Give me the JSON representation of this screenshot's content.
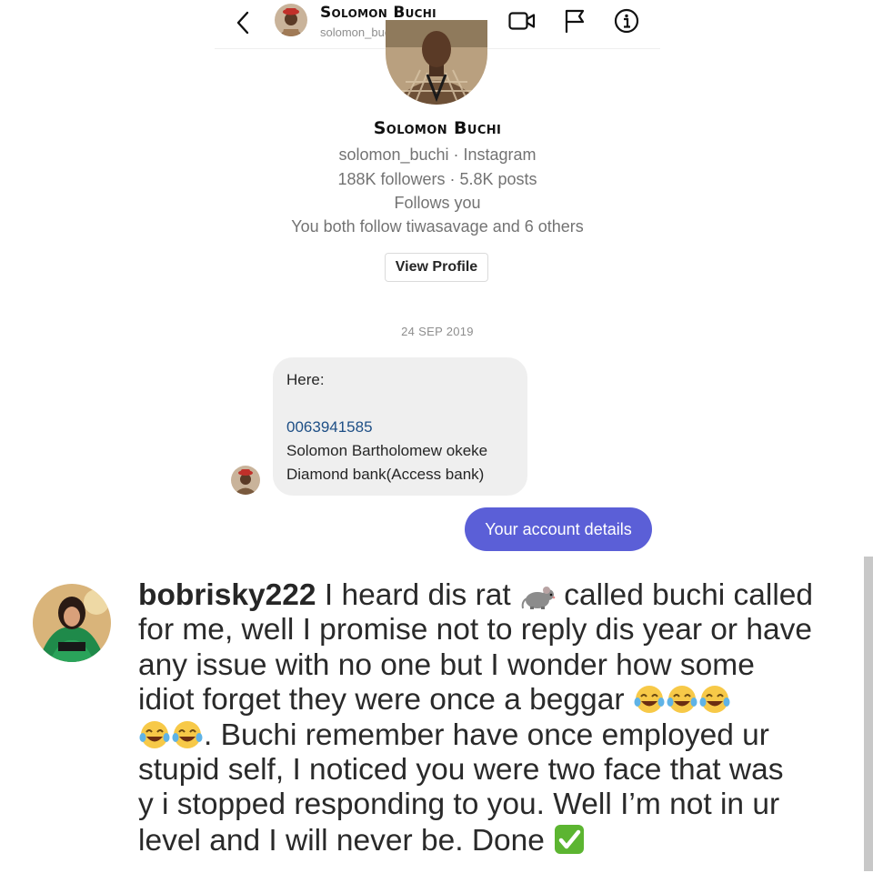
{
  "dm": {
    "header": {
      "name": "Solomon Buchi",
      "username": "solomon_buchi",
      "icons": [
        "back-chevron-icon",
        "video-call-icon",
        "flag-icon",
        "info-icon"
      ]
    },
    "profile": {
      "name": "Solomon Buchi",
      "handle_line": "solomon_buchi · Instagram",
      "stats_line": "188K followers · 5.8K posts",
      "follows_line": "Follows you",
      "mutual_line": "You both follow tiwasavage and 6 others",
      "view_profile_label": "View Profile"
    },
    "date_separator": "24 SEP 2019",
    "incoming_message": {
      "line1": "Here:",
      "account_number": "0063941585",
      "account_name": "Solomon Bartholomew okeke",
      "bank": "Diamond bank(Access bank)"
    },
    "outgoing_message": "Your account details",
    "colors": {
      "outgoing_bubble": "#5b5fd7",
      "incoming_bubble": "#efefef",
      "link_number": "#1e4f86"
    }
  },
  "comment": {
    "username": "bobrisky222",
    "line1_after_user": " I heard dis rat ",
    "line1_tail": " called buchi called",
    "line2": "for me, well I promise not to reply dis year or have",
    "line3": "any issue with no one but I wonder how some",
    "line4": "idiot forget they were once a beggar ",
    "line5_tail": ". Buchi remember have once employed ur",
    "line6": "stupid self, I noticed you were two face that was",
    "line7": "y i stopped responding to you. Well I’m not in ur",
    "line8": "level and I will never be. Done ",
    "emojis": [
      "rat-emoji",
      "tears-of-joy-emoji",
      "check-mark-button-emoji"
    ]
  }
}
